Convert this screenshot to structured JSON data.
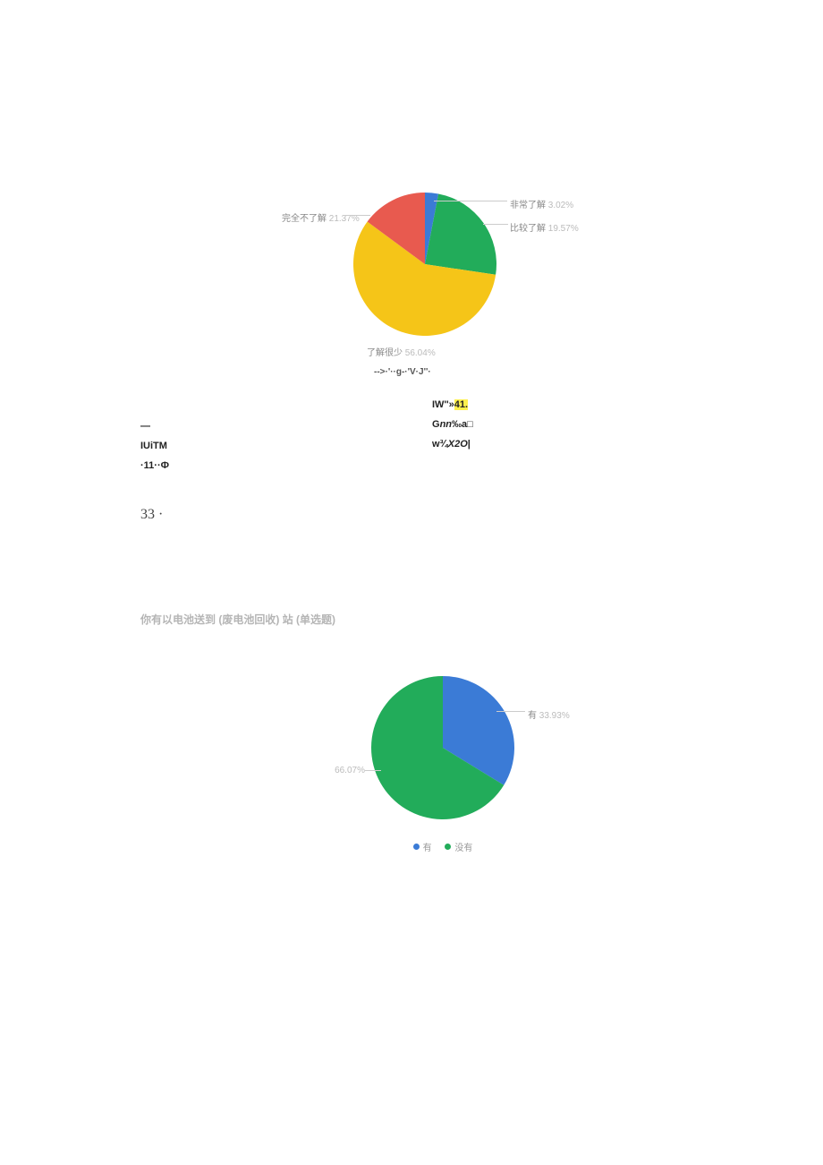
{
  "chart_data": [
    {
      "type": "pie",
      "title": "",
      "series": [
        {
          "name": "非常了解",
          "value": 3.02,
          "color": "#3b7bd6"
        },
        {
          "name": "比较了解",
          "value": 19.57,
          "color": "#22ac5a"
        },
        {
          "name": "了解很少",
          "value": 56.04,
          "color": "#f5c518"
        },
        {
          "name": "完全不了解",
          "value": 21.37,
          "color": "#e85a4f"
        }
      ],
      "legend_label": "-->·'··g-·'V·J''·"
    },
    {
      "type": "pie",
      "title": "",
      "series": [
        {
          "name": "有",
          "value": 33.93,
          "color": "#3b7bd6"
        },
        {
          "name": "没有",
          "value": 66.07,
          "color": "#22ac5a"
        }
      ]
    }
  ],
  "text_rows": {
    "left": [
      "—",
      "IUiTM",
      "·11··Ф"
    ],
    "right": [
      "IW''»41.",
      "Gnn‰a□",
      "w¾X2O|"
    ]
  },
  "page_number": "33 ·",
  "section_heading": "你有以电池送到 (废电池回收) 站 (单选题)"
}
